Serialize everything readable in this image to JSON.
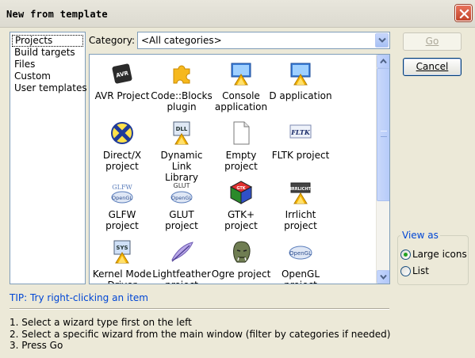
{
  "window": {
    "title": "New from template",
    "close_icon": "close-icon"
  },
  "sidebar": {
    "items": [
      {
        "label": "Projects",
        "selected": true
      },
      {
        "label": "Build targets"
      },
      {
        "label": "Files"
      },
      {
        "label": "Custom"
      },
      {
        "label": "User templates"
      }
    ]
  },
  "category": {
    "label": "Category:",
    "selected": "<All categories>"
  },
  "buttons": {
    "go": "Go",
    "cancel": "Cancel"
  },
  "wizards": [
    {
      "label": "AVR Project",
      "icon": "avr-chip-icon"
    },
    {
      "label": "Code::Blocks\nplugin",
      "icon": "puzzle-piece-icon"
    },
    {
      "label": "Console\napplication",
      "icon": "console-app-icon"
    },
    {
      "label": "D application",
      "icon": "d-app-icon"
    },
    {
      "label": "Direct/X\nproject",
      "icon": "directx-icon"
    },
    {
      "label": "Dynamic Link\nLibrary",
      "icon": "dll-icon"
    },
    {
      "label": "Empty\nproject",
      "icon": "empty-document-icon"
    },
    {
      "label": "FLTK project",
      "icon": "fltk-icon"
    },
    {
      "label": "GLFW\nproject",
      "icon": "glfw-icon"
    },
    {
      "label": "GLUT\nproject",
      "icon": "glut-icon"
    },
    {
      "label": "GTK+\nproject",
      "icon": "gtk-cube-icon"
    },
    {
      "label": "Irrlicht\nproject",
      "icon": "irrlicht-icon"
    },
    {
      "label": "Kernel Mode\nDriver",
      "icon": "sys-driver-icon"
    },
    {
      "label": "Lightfeather\nproject",
      "icon": "feather-icon"
    },
    {
      "label": "Ogre project",
      "icon": "ogre-head-icon"
    },
    {
      "label": "OpenGL\nproject",
      "icon": "opengl-icon"
    }
  ],
  "icon_texts": {
    "avr": "AVR",
    "dll": "DLL",
    "fltk": "FLTK",
    "glfw": "GLFW",
    "glut": "GLUT",
    "opengl": "OpenGL",
    "irrlicht": "IRRLICHT",
    "sys": "SYS",
    "gtk": "GTK"
  },
  "view_as": {
    "title": "View as",
    "options": [
      {
        "label": "Large icons",
        "checked": true
      },
      {
        "label": "List",
        "checked": false
      }
    ]
  },
  "tip": "TIP: Try right-clicking an item",
  "instructions": [
    "1. Select a wizard type first on the left",
    "2. Select a specific wizard from the main window (filter by categories if needed)",
    "3. Press Go"
  ],
  "colors": {
    "accent": "#0046d5",
    "panel_border": "#7f9db9",
    "dialog_bg": "#ece9d8"
  }
}
